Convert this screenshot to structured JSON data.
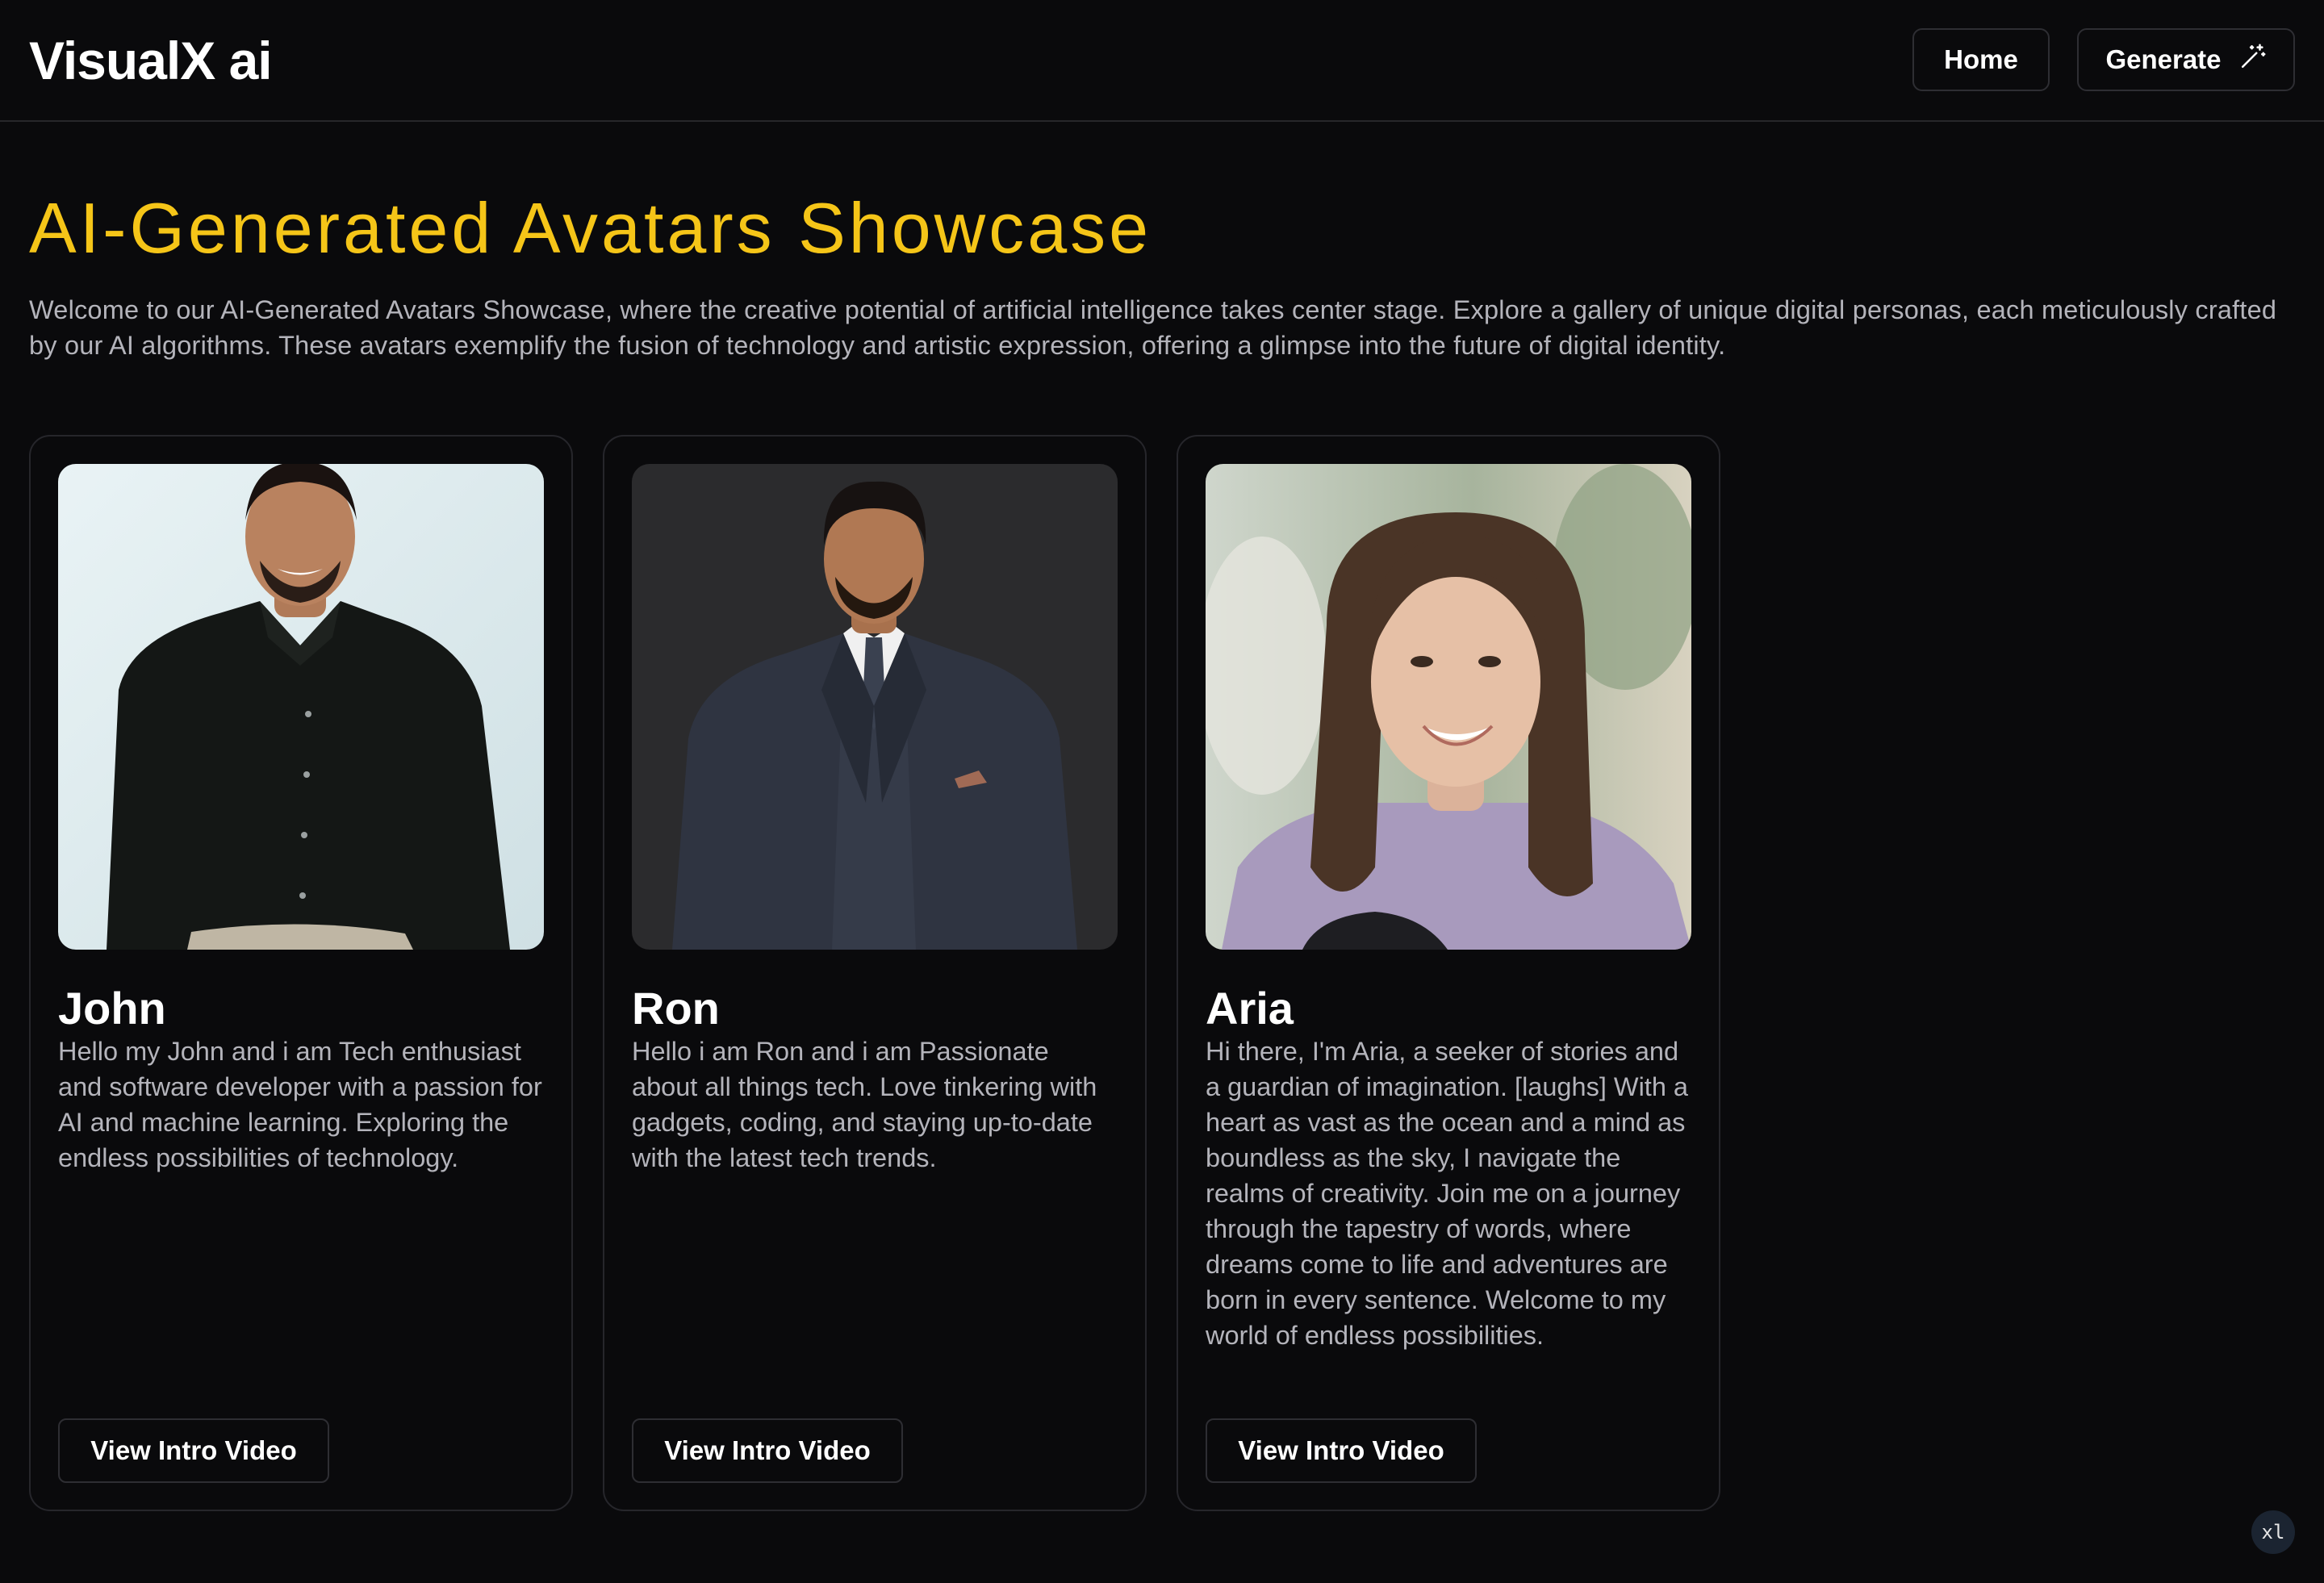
{
  "header": {
    "brand": "VisualX ai",
    "nav": {
      "home_label": "Home",
      "generate_label": "Generate",
      "generate_icon": "magic-wand-icon"
    }
  },
  "hero": {
    "title": "AI-Generated Avatars Showcase",
    "description": "Welcome to our AI-Generated Avatars Showcase, where the creative potential of artificial intelligence takes center stage. Explore a gallery of unique digital personas, each meticulously crafted by our AI algorithms. These avatars exemplify the fusion of technology and artistic expression, offering a glimpse into the future of digital identity."
  },
  "avatars": [
    {
      "name": "John",
      "bio": "Hello my John and i am Tech enthusiast and software developer with a passion for AI and machine learning. Exploring the endless possibilities of technology.",
      "button_label": "View Intro Video"
    },
    {
      "name": "Ron",
      "bio": "Hello i am Ron and i am Passionate about all things tech. Love tinkering with gadgets, coding, and staying up-to-date with the latest tech trends.",
      "button_label": "View Intro Video"
    },
    {
      "name": "Aria",
      "bio": "Hi there, I'm Aria, a seeker of stories and a guardian of imagination. [laughs] With a heart as vast as the ocean and a mind as boundless as the sky, I navigate the realms of creativity. Join me on a journey through the tapestry of words, where dreams come to life and adventures are born in every sentence. Welcome to my world of endless possibilities.",
      "button_label": "View Intro Video"
    }
  ],
  "corner_badge": "xl",
  "colors": {
    "background": "#0a0a0c",
    "accent": "#f5c518",
    "muted_text": "#b4b4bb",
    "border": "#27272a"
  }
}
